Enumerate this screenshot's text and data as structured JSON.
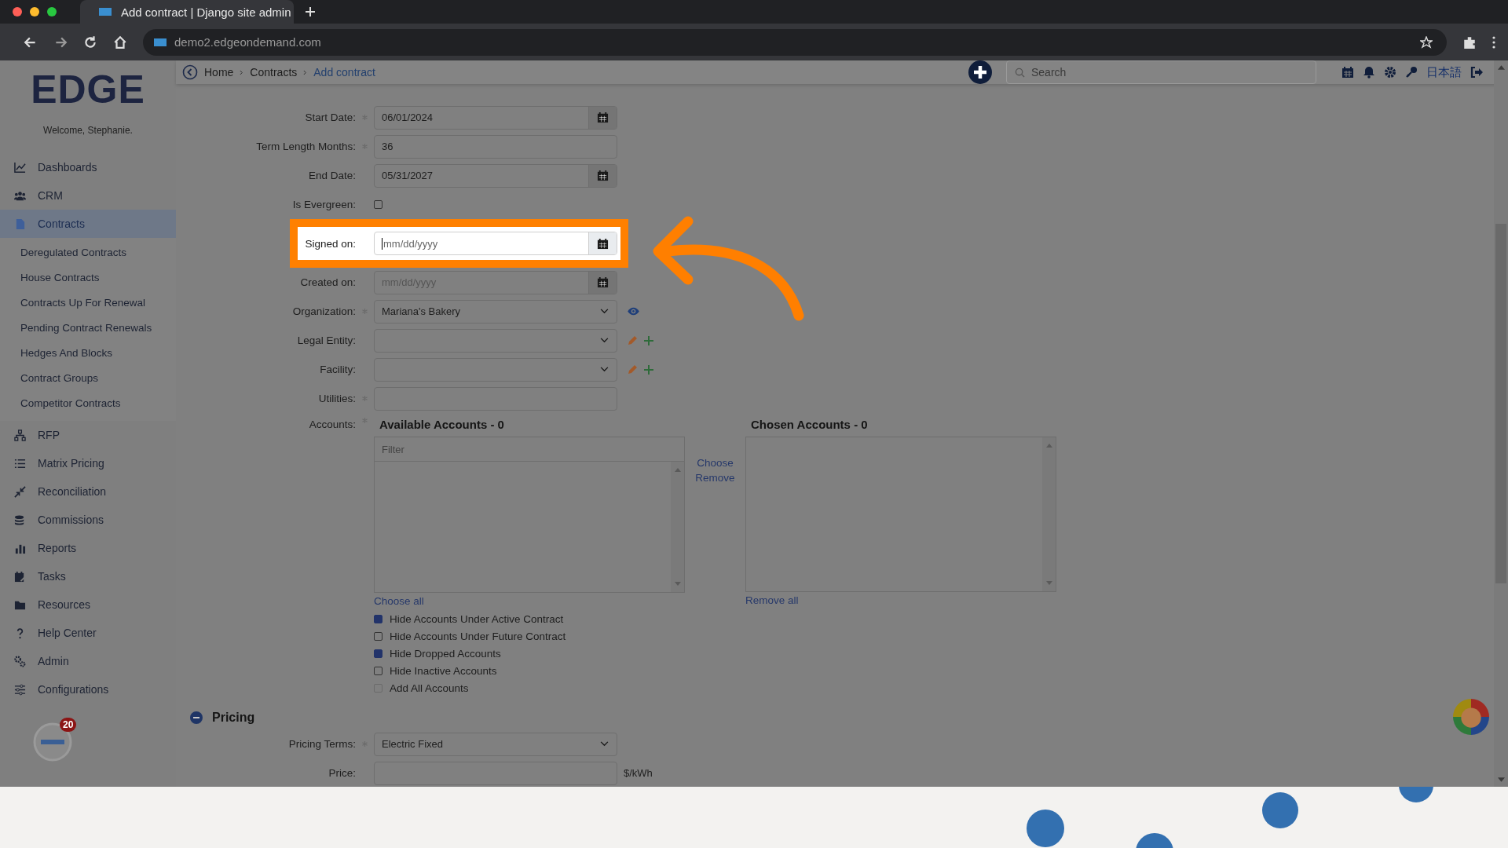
{
  "browser": {
    "tab_title": "Add contract | Django site admin",
    "url": "demo2.edgeondemand.com"
  },
  "sidebar": {
    "logo": "EDGE",
    "welcome": "Welcome, Stephanie.",
    "badge_count": "20",
    "items": [
      {
        "label": "Dashboards",
        "selected": false
      },
      {
        "label": "CRM",
        "selected": false
      },
      {
        "label": "Contracts",
        "selected": true,
        "children": [
          {
            "label": "Deregulated Contracts"
          },
          {
            "label": "House Contracts"
          },
          {
            "label": "Contracts Up For Renewal"
          },
          {
            "label": "Pending Contract Renewals"
          },
          {
            "label": "Hedges And Blocks"
          },
          {
            "label": "Contract Groups"
          },
          {
            "label": "Competitor Contracts"
          }
        ]
      },
      {
        "label": "RFP",
        "selected": false
      },
      {
        "label": "Matrix Pricing",
        "selected": false
      },
      {
        "label": "Reconciliation",
        "selected": false
      },
      {
        "label": "Commissions",
        "selected": false
      },
      {
        "label": "Reports",
        "selected": false
      },
      {
        "label": "Tasks",
        "selected": false
      },
      {
        "label": "Resources",
        "selected": false
      },
      {
        "label": "Help Center",
        "selected": false
      },
      {
        "label": "Admin",
        "selected": false
      },
      {
        "label": "Configurations",
        "selected": false
      }
    ]
  },
  "header": {
    "breadcrumbs": [
      {
        "label": "Home",
        "current": false
      },
      {
        "label": "Contracts",
        "current": false
      },
      {
        "label": "Add contract",
        "current": true
      }
    ],
    "search_placeholder": "Search",
    "language": "日本語"
  },
  "form": {
    "rows": [
      {
        "kind": "date",
        "label": "Start Date:",
        "required": true,
        "value": "06/01/2024",
        "highlighted": false
      },
      {
        "kind": "text",
        "label": "Term Length Months:",
        "required": true,
        "value": "36",
        "highlighted": false
      },
      {
        "kind": "date",
        "label": "End Date:",
        "required": false,
        "value": "05/31/2027",
        "highlighted": false
      },
      {
        "kind": "checkbox",
        "label": "Is Evergreen:",
        "required": false,
        "checked": false,
        "highlighted": false
      },
      {
        "kind": "date",
        "label": "Signed on:",
        "required": false,
        "placeholder": "mm/dd/yyyy",
        "highlighted": true
      },
      {
        "kind": "date",
        "label": "Created on:",
        "required": false,
        "placeholder": "mm/dd/yyyy",
        "highlighted": false
      },
      {
        "kind": "select",
        "label": "Organization:",
        "required": true,
        "value": "Mariana's Bakery",
        "viewable": true,
        "highlighted": false
      },
      {
        "kind": "select",
        "label": "Legal Entity:",
        "required": false,
        "editable": true,
        "highlighted": false
      },
      {
        "kind": "select",
        "label": "Facility:",
        "required": false,
        "editable": true,
        "highlighted": false
      },
      {
        "kind": "text",
        "label": "Utilities:",
        "required": true,
        "highlighted": false
      }
    ],
    "accounts": {
      "label": "Accounts:",
      "required": true,
      "available_title": "Available Accounts - 0",
      "chosen_title": "Chosen Accounts - 0",
      "filter_placeholder": "Filter",
      "choose": "Choose",
      "remove": "Remove",
      "choose_all": "Choose all",
      "remove_all": "Remove all",
      "options": [
        {
          "label": "Hide Accounts Under Active Contract",
          "checked": true,
          "disabled": false
        },
        {
          "label": "Hide Accounts Under Future Contract",
          "checked": false,
          "disabled": false
        },
        {
          "label": "Hide Dropped Accounts",
          "checked": true,
          "disabled": false
        },
        {
          "label": "Hide Inactive Accounts",
          "checked": false,
          "disabled": false
        },
        {
          "label": "Add All Accounts",
          "checked": false,
          "disabled": true
        }
      ]
    }
  },
  "pricing": {
    "title": "Pricing",
    "expanded": true,
    "rows": [
      {
        "kind": "select",
        "label": "Pricing Terms:",
        "required": true,
        "value": "Electric Fixed"
      },
      {
        "kind": "text",
        "label": "Price:",
        "required": false,
        "unit": "$/kWh"
      }
    ]
  }
}
